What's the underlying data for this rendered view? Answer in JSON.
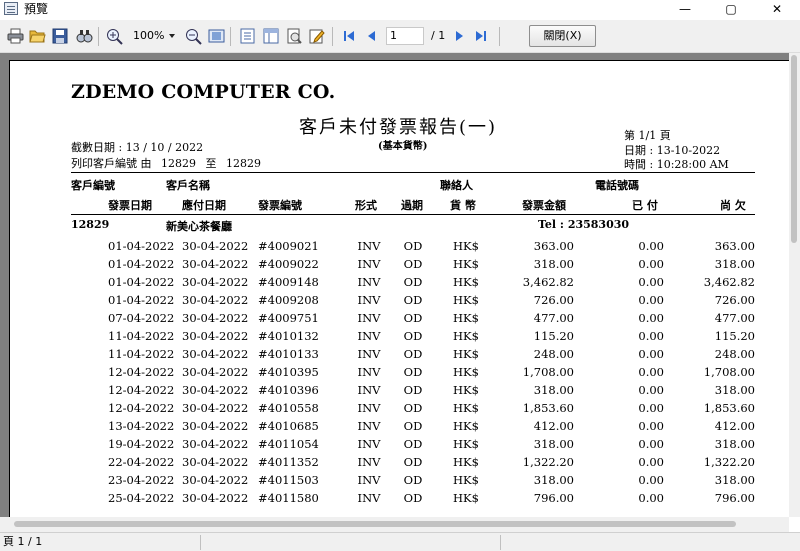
{
  "window": {
    "title": "預覽",
    "minimize_glyph": "—",
    "maximize_glyph": "▢",
    "close_glyph": "✕"
  },
  "toolbar": {
    "zoom": "100%",
    "page_current": "1",
    "page_total": "/ 1",
    "close_label": "關閉(X)",
    "icons": [
      "print-icon",
      "open-folder-icon",
      "save-icon",
      "find-icon",
      "zoom-in-icon",
      "zoom-out-icon",
      "page-fit-icon",
      "page-view-icon",
      "page-width-icon",
      "export-icon",
      "edit-icon",
      "first-page-icon",
      "prev-page-icon",
      "next-page-icon",
      "last-page-icon"
    ]
  },
  "report": {
    "company": "ZDEMO COMPUTER CO.",
    "title": "客戶未付發票報告(一)",
    "subtitle": "(基本貨幣)",
    "cutoff_label": "截數日期 :",
    "cutoff_value": "13 / 10 / 2022",
    "range_label": "列印客戶編號 由",
    "range_from": "12829",
    "range_to_label": "至",
    "range_to": "12829",
    "page_info": "第 1/1 頁",
    "date_info": "日期 : 13-10-2022",
    "time_info": "時間 : 10:28:00 AM",
    "headers1": {
      "cust_no": "客戶編號",
      "cust_name": "客戶名稱",
      "contact": "聯絡人",
      "phone": "電話號碼"
    },
    "headers2": {
      "inv_date": "發票日期",
      "due_date": "應付日期",
      "inv_no": "發票編號",
      "type": "形式",
      "terms": "過期",
      "currency": "貨 幣",
      "amount": "發票金額",
      "paid": "已 付",
      "owing": "尚 欠"
    },
    "customer": {
      "no": "12829",
      "name": "新美心茶餐廳",
      "tel": "Tel : 23583030"
    },
    "rows": [
      {
        "inv_date": "01-04-2022",
        "due_date": "30-04-2022",
        "inv_no": "#4009021",
        "type": "INV",
        "terms": "OD",
        "currency": "HK$",
        "amount": "363.00",
        "paid": "0.00",
        "owing": "363.00"
      },
      {
        "inv_date": "01-04-2022",
        "due_date": "30-04-2022",
        "inv_no": "#4009022",
        "type": "INV",
        "terms": "OD",
        "currency": "HK$",
        "amount": "318.00",
        "paid": "0.00",
        "owing": "318.00"
      },
      {
        "inv_date": "01-04-2022",
        "due_date": "30-04-2022",
        "inv_no": "#4009148",
        "type": "INV",
        "terms": "OD",
        "currency": "HK$",
        "amount": "3,462.82",
        "paid": "0.00",
        "owing": "3,462.82"
      },
      {
        "inv_date": "01-04-2022",
        "due_date": "30-04-2022",
        "inv_no": "#4009208",
        "type": "INV",
        "terms": "OD",
        "currency": "HK$",
        "amount": "726.00",
        "paid": "0.00",
        "owing": "726.00"
      },
      {
        "inv_date": "07-04-2022",
        "due_date": "30-04-2022",
        "inv_no": "#4009751",
        "type": "INV",
        "terms": "OD",
        "currency": "HK$",
        "amount": "477.00",
        "paid": "0.00",
        "owing": "477.00"
      },
      {
        "inv_date": "11-04-2022",
        "due_date": "30-04-2022",
        "inv_no": "#4010132",
        "type": "INV",
        "terms": "OD",
        "currency": "HK$",
        "amount": "115.20",
        "paid": "0.00",
        "owing": "115.20"
      },
      {
        "inv_date": "11-04-2022",
        "due_date": "30-04-2022",
        "inv_no": "#4010133",
        "type": "INV",
        "terms": "OD",
        "currency": "HK$",
        "amount": "248.00",
        "paid": "0.00",
        "owing": "248.00"
      },
      {
        "inv_date": "12-04-2022",
        "due_date": "30-04-2022",
        "inv_no": "#4010395",
        "type": "INV",
        "terms": "OD",
        "currency": "HK$",
        "amount": "1,708.00",
        "paid": "0.00",
        "owing": "1,708.00"
      },
      {
        "inv_date": "12-04-2022",
        "due_date": "30-04-2022",
        "inv_no": "#4010396",
        "type": "INV",
        "terms": "OD",
        "currency": "HK$",
        "amount": "318.00",
        "paid": "0.00",
        "owing": "318.00"
      },
      {
        "inv_date": "12-04-2022",
        "due_date": "30-04-2022",
        "inv_no": "#4010558",
        "type": "INV",
        "terms": "OD",
        "currency": "HK$",
        "amount": "1,853.60",
        "paid": "0.00",
        "owing": "1,853.60"
      },
      {
        "inv_date": "13-04-2022",
        "due_date": "30-04-2022",
        "inv_no": "#4010685",
        "type": "INV",
        "terms": "OD",
        "currency": "HK$",
        "amount": "412.00",
        "paid": "0.00",
        "owing": "412.00"
      },
      {
        "inv_date": "19-04-2022",
        "due_date": "30-04-2022",
        "inv_no": "#4011054",
        "type": "INV",
        "terms": "OD",
        "currency": "HK$",
        "amount": "318.00",
        "paid": "0.00",
        "owing": "318.00"
      },
      {
        "inv_date": "22-04-2022",
        "due_date": "30-04-2022",
        "inv_no": "#4011352",
        "type": "INV",
        "terms": "OD",
        "currency": "HK$",
        "amount": "1,322.20",
        "paid": "0.00",
        "owing": "1,322.20"
      },
      {
        "inv_date": "23-04-2022",
        "due_date": "30-04-2022",
        "inv_no": "#4011503",
        "type": "INV",
        "terms": "OD",
        "currency": "HK$",
        "amount": "318.00",
        "paid": "0.00",
        "owing": "318.00"
      },
      {
        "inv_date": "25-04-2022",
        "due_date": "30-04-2022",
        "inv_no": "#4011580",
        "type": "INV",
        "terms": "OD",
        "currency": "HK$",
        "amount": "796.00",
        "paid": "0.00",
        "owing": "796.00"
      }
    ]
  },
  "status": {
    "page": "頁 1 / 1"
  }
}
